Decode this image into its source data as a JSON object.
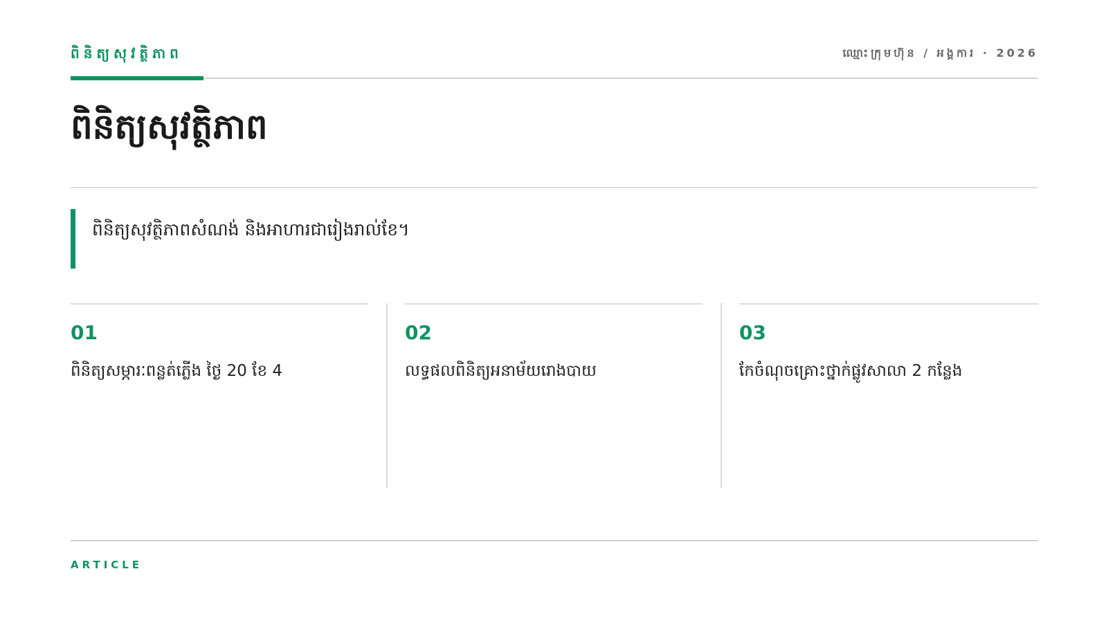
{
  "header": {
    "kicker": "ពិនិត្យសុវត្ថិភាព",
    "meta": "ឈ្មោះក្រុមហ៊ុន / អង្គការ · 2026"
  },
  "title": "ពិនិត្យសុវត្ថិភាព",
  "lead": "ពិនិត្យសុវត្ថិភាពសំណង់ និងអាហារជារៀងរាល់ខែ។",
  "columns": [
    {
      "number": "01",
      "text": "ពិនិត្យសម្ភារៈពន្លត់ភ្លើង ថ្ងៃ 20 ខែ 4"
    },
    {
      "number": "02",
      "text": "លទ្ធផលពិនិត្យអនាម័យរោងបាយ"
    },
    {
      "number": "03",
      "text": "កែចំណុចគ្រោះថ្នាក់ផ្លូវសាលា 2 កន្លែង"
    }
  ],
  "footer": {
    "label": "ARTICLE"
  },
  "colors": {
    "accent": "#0e9460",
    "rule": "#dcdcdc",
    "text": "#1f1f1f",
    "muted": "#6b6b6b"
  }
}
